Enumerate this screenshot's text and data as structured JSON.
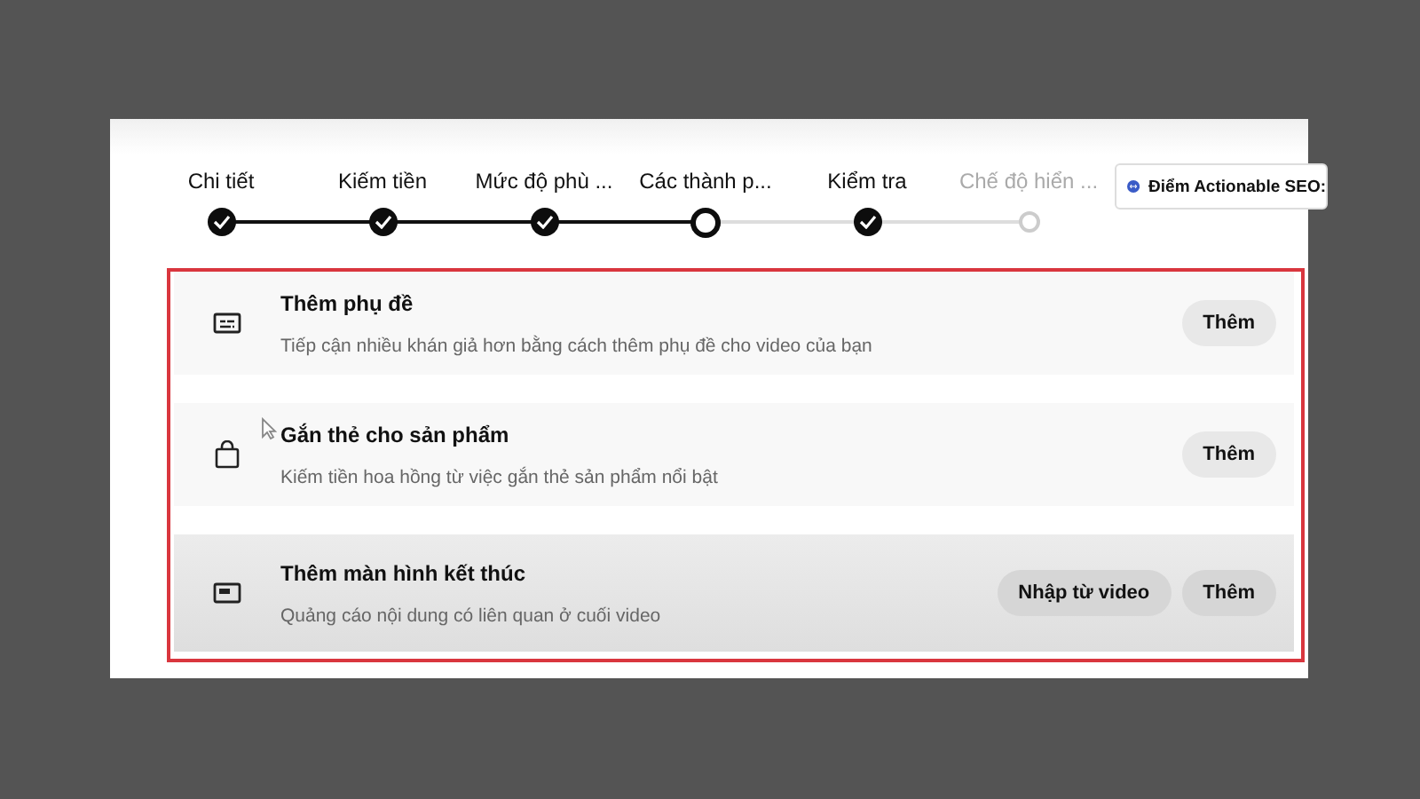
{
  "steps": [
    {
      "label": "Chi tiết",
      "completed": true,
      "selected": false
    },
    {
      "label": "Kiếm tiền",
      "completed": true,
      "selected": false
    },
    {
      "label": "Mức độ phù ...",
      "completed": true,
      "selected": false
    },
    {
      "label": "Các thành p...",
      "completed": false,
      "selected": true
    },
    {
      "label": "Kiểm tra",
      "completed": true,
      "selected": false
    },
    {
      "label": "Chế độ hiển ...",
      "completed": false,
      "selected": false
    }
  ],
  "seo_badge": {
    "label": "Điểm Actionable SEO:"
  },
  "items": [
    {
      "kind": "subtitles",
      "title": "Thêm phụ đề",
      "description": "Tiếp cận nhiều khán giả hơn bằng cách thêm phụ đề cho video của bạn",
      "hovered": false,
      "buttons": [
        "Thêm"
      ]
    },
    {
      "kind": "product",
      "title": "Gắn thẻ cho sản phẩm",
      "description": "Kiếm tiền hoa hồng từ việc gắn thẻ sản phẩm nổi bật",
      "hovered": false,
      "buttons": [
        "Thêm"
      ]
    },
    {
      "kind": "endscreen",
      "title": "Thêm màn hình kết thúc",
      "description": "Quảng cáo nội dung có liên quan ở cuối video",
      "hovered": true,
      "buttons": [
        "Nhập từ video",
        "Thêm"
      ]
    }
  ]
}
